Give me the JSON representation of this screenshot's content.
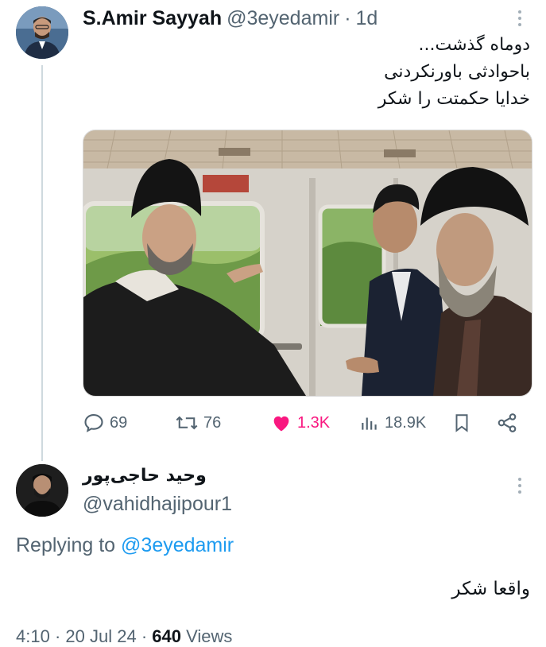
{
  "tweet": {
    "author_name": "S.Amir Sayyah",
    "author_handle": "@3eyedamir",
    "separator": "·",
    "time": "1d",
    "text_lines": [
      "دوماه گذشت...",
      "باحوادثی باورنکردنی",
      "خدایا حکمتت را شکر"
    ],
    "media_alt": "photo",
    "stats": {
      "replies": "69",
      "retweets": "76",
      "likes": "1.3K",
      "views": "18.9K"
    },
    "icons": [
      "reply-icon",
      "retweet-icon",
      "heart-icon",
      "views-icon",
      "bookmark-icon",
      "share-icon",
      "more-icon"
    ],
    "like_color": "#f91880"
  },
  "reply": {
    "author_name": "وحید حاجی‌پور",
    "author_handle": "@vahidhajipour1",
    "replying_label": "Replying to",
    "replying_handle": "@3eyedamir",
    "text": "واقعا شکر",
    "meta_time": "4:10",
    "meta_date": "20 Jul 24",
    "meta_views_count": "640",
    "meta_views_label": "Views"
  },
  "colors": {
    "link": "#1d9bf0",
    "muted": "#536471",
    "text": "#0f1419"
  }
}
